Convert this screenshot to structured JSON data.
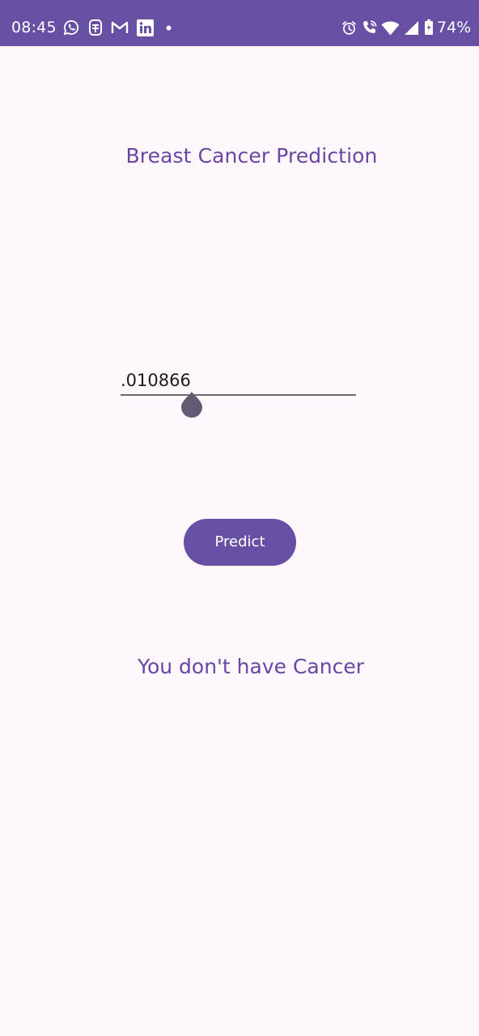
{
  "status_bar": {
    "time": "08:45",
    "battery_percent": "74%",
    "background": "#6750a4",
    "left_icons": [
      "whatsapp-icon",
      "notification-app-icon",
      "gmail-icon",
      "linkedin-icon",
      "more-notifications-dot"
    ],
    "right_icons": [
      "alarm-icon",
      "wifi-calling-icon",
      "wifi-icon",
      "cellular-signal-icon",
      "battery-icon"
    ]
  },
  "app": {
    "title": "Breast Cancer Prediction",
    "input": {
      "value": ".010866"
    },
    "predict_button_label": "Predict",
    "result": "You don't have Cancer",
    "accent": "#6750a4",
    "text_accent": "#6a45a5"
  }
}
